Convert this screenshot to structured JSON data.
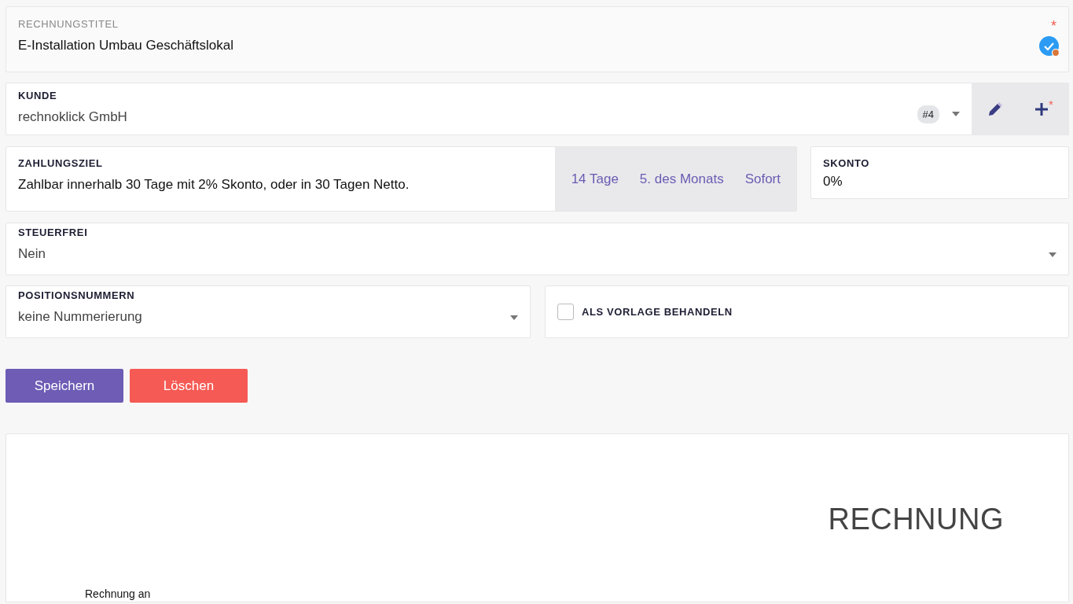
{
  "title_field": {
    "label": "RECHNUNGSTITEL",
    "value": "E-Installation Umbau Geschäftslokal",
    "required_mark": "*"
  },
  "customer": {
    "label": "KUNDE",
    "value": "rechnoklick GmbH",
    "badge": "#4",
    "add_mark": "*"
  },
  "payment_term": {
    "label": "ZAHLUNGSZIEL",
    "value": "Zahlbar innerhalb 30 Tage mit 2% Skonto, oder in 30 Tagen Netto.",
    "presets": [
      "14 Tage",
      "5. des Monats",
      "Sofort"
    ]
  },
  "discount": {
    "label": "SKONTO",
    "value": "0%"
  },
  "tax_free": {
    "label": "STEUERFREI",
    "value": "Nein"
  },
  "position_numbers": {
    "label": "POSITIONSNUMMERN",
    "value": "keine Nummerierung"
  },
  "template": {
    "label": "ALS VORLAGE BEHANDELN",
    "checked": false
  },
  "buttons": [
    {
      "label": "Speichern",
      "kind": "primary"
    },
    {
      "label": "Löschen",
      "kind": "danger"
    }
  ],
  "preview": {
    "heading": "RECHNUNG",
    "recipient_label": "Rechnung an"
  }
}
